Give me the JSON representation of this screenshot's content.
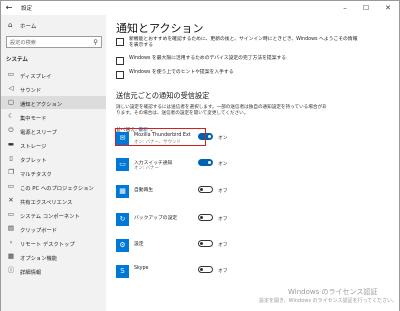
{
  "window": {
    "title": "設定"
  },
  "sidebar": {
    "home_label": "ホーム",
    "search_placeholder": "設定の検索",
    "section_title": "システム",
    "items": [
      {
        "label": "ディスプレイ",
        "icon": "display-icon"
      },
      {
        "label": "サウンド",
        "icon": "sound-icon"
      },
      {
        "label": "通知とアクション",
        "icon": "notifications-icon",
        "selected": true
      },
      {
        "label": "集中モード",
        "icon": "focus-assist-icon"
      },
      {
        "label": "電源とスリープ",
        "icon": "power-icon"
      },
      {
        "label": "ストレージ",
        "icon": "storage-icon"
      },
      {
        "label": "タブレット",
        "icon": "tablet-icon"
      },
      {
        "label": "マルチタスク",
        "icon": "multitasking-icon"
      },
      {
        "label": "この PC へのプロジェクション",
        "icon": "projection-icon"
      },
      {
        "label": "共有エクスペリエンス",
        "icon": "shared-experience-icon"
      },
      {
        "label": "システム コンポーネント",
        "icon": "components-icon"
      },
      {
        "label": "クリップボード",
        "icon": "clipboard-icon"
      },
      {
        "label": "リモート デスクトップ",
        "icon": "remote-desktop-icon"
      },
      {
        "label": "オプション機能",
        "icon": "optional-features-icon"
      },
      {
        "label": "詳細情報",
        "icon": "about-icon"
      }
    ]
  },
  "main": {
    "title": "通知とアクション",
    "checkboxes": [
      {
        "label": "新機能とおすすめを確認するために、更新の後と、サインイン時にときどき、Windows へようこその情報を表示する"
      },
      {
        "label": "Windows を最大限に活用するためのデバイス設定の完了方法を提案する"
      },
      {
        "label": "Windows を使う上でのヒントや提案を入手する"
      }
    ],
    "senders_title": "送信元ごとの通知の受信設定",
    "senders_desc": "詳しい設定を確認するには送信者を選択します。一部の送信者は独自の通知設定を持っている場合があります。その場合は、送信者の設定を開いて変更してください。",
    "sort_label": "並べ替え:",
    "sort_value": "最新",
    "apps": [
      {
        "name": "Mozilla Thunderbird Ext",
        "sub": "オン: バナー、サウンド",
        "state": "オン",
        "on": true,
        "icon": "thunderbird-icon"
      },
      {
        "name": "入力スイッチ通知",
        "sub": "オン: バナー",
        "state": "オン",
        "on": true,
        "icon": "input-switch-icon"
      },
      {
        "name": "自動再生",
        "sub": "",
        "state": "オフ",
        "on": false,
        "icon": "autoplay-icon"
      },
      {
        "name": "バックアップの設定",
        "sub": "",
        "state": "オフ",
        "on": false,
        "icon": "backup-icon"
      },
      {
        "name": "設定",
        "sub": "",
        "state": "オフ",
        "on": false,
        "icon": "settings-gear-icon"
      },
      {
        "name": "Skype",
        "sub": "",
        "state": "オフ",
        "on": false,
        "icon": "skype-icon"
      }
    ]
  },
  "watermark": {
    "title": "Windows のライセンス認証",
    "subtitle": "設定を開き、Windows のライセンス認証を行ってください。"
  },
  "colors": {
    "accent": "#0063b1",
    "tile": "#0078d7",
    "highlight": "#d32020",
    "sidebar_bg": "#f2f2f2"
  }
}
